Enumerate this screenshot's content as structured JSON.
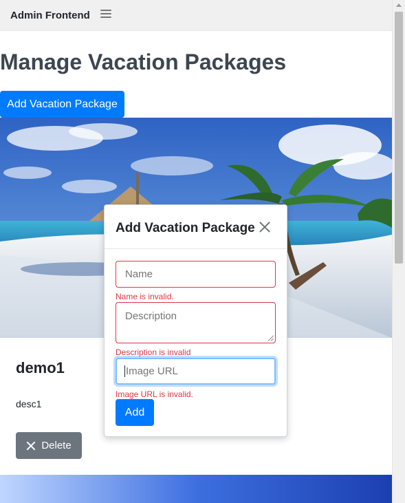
{
  "navbar": {
    "brand": "Admin Frontend",
    "menu_icon": "hamburger-menu-icon"
  },
  "page": {
    "title": "Manage Vacation Packages",
    "add_button_label": "Add Vacation Package"
  },
  "package": {
    "name": "demo1",
    "description": "desc1",
    "delete_label": "Delete",
    "image": "beach-palm-trees-image"
  },
  "modal": {
    "title": "Add Vacation Package",
    "close_icon": "close-icon",
    "name_placeholder": "Name",
    "name_error": "Name is invalid.",
    "description_placeholder": "Description",
    "description_error": "Description is invalid",
    "image_url_placeholder": "Image URL",
    "image_url_error": "Image URL is invalid.",
    "submit_label": "Add"
  },
  "colors": {
    "primary": "#007bff",
    "secondary": "#6c757d",
    "danger": "#dc3545",
    "focus": "#80bdff"
  }
}
